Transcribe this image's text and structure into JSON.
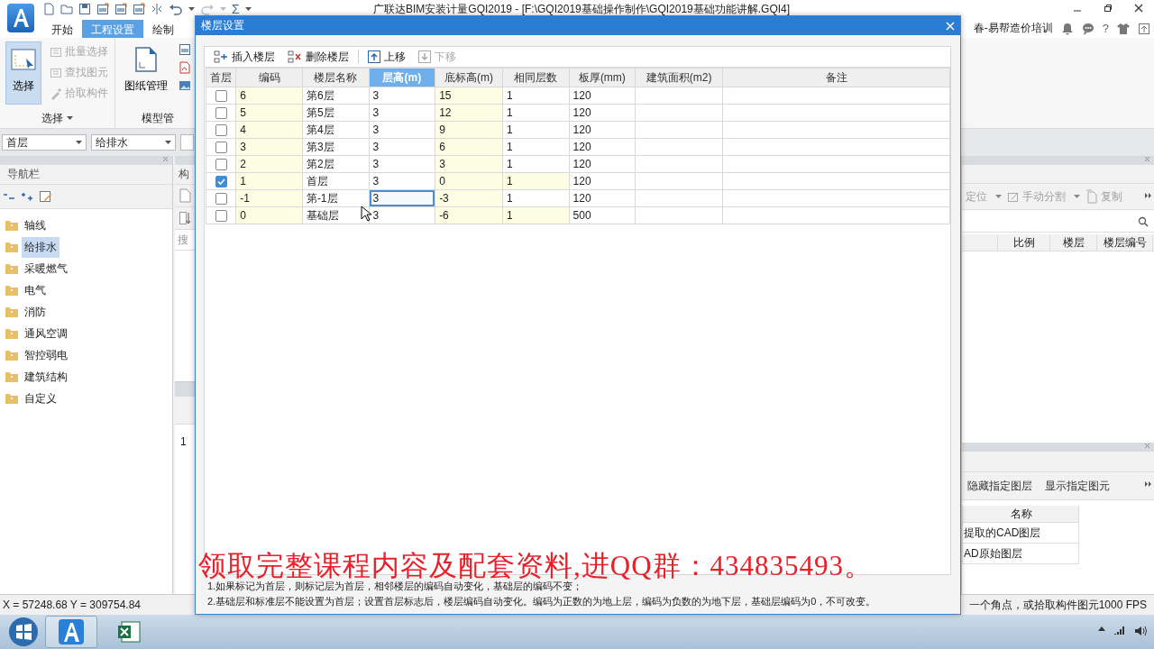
{
  "window": {
    "title": "广联达BIM安装计量GQI2019 - [F:\\GQI2019基础操作制作\\GQI2019基础功能讲解.GQI4]",
    "user": "春-易帮造价培训",
    "help_label": "?",
    "sum_symbol": "Σ"
  },
  "menu_tabs": [
    {
      "label": "开始",
      "selected": false
    },
    {
      "label": "工程设置",
      "selected": true
    },
    {
      "label": "绘制",
      "selected": false
    }
  ],
  "ribbon": {
    "groups": [
      {
        "label": "选择",
        "large": {
          "label": "选择",
          "selected": true
        },
        "small": [
          {
            "label": "批量选择",
            "disabled": true
          },
          {
            "label": "查找图元",
            "disabled": true
          },
          {
            "label": "拾取构件",
            "disabled": true
          }
        ]
      },
      {
        "label": "模型管",
        "large": {
          "label": "图纸管理",
          "selected": false
        }
      }
    ]
  },
  "selectors": [
    "首层",
    "给排水"
  ],
  "nav_panel": {
    "title": "导航栏",
    "items": [
      {
        "label": "轴线",
        "selected": false
      },
      {
        "label": "给排水",
        "selected": true
      },
      {
        "label": "采暖燃气",
        "selected": false
      },
      {
        "label": "电气",
        "selected": false
      },
      {
        "label": "消防",
        "selected": false
      },
      {
        "label": "通风空调",
        "selected": false
      },
      {
        "label": "智控弱电",
        "selected": false
      },
      {
        "label": "建筑结构",
        "selected": false
      },
      {
        "label": "自定义",
        "selected": false
      }
    ]
  },
  "middle_panel": {
    "title": "构",
    "search_placeholder": "搜",
    "row_number": "1"
  },
  "layer_panel": {
    "toolbar": [
      {
        "label": "定位",
        "dropdown": true
      },
      {
        "label": "手动分割",
        "dropdown": true
      },
      {
        "label": "复制",
        "dropdown": false
      }
    ],
    "columns": [
      "比例",
      "楼层",
      "楼层编号"
    ]
  },
  "cad_panel": {
    "toolbar": [
      "隐藏指定图层",
      "显示指定图元"
    ],
    "columns": [
      "名称"
    ],
    "rows": [
      "提取的CAD图层",
      "AD原始图层"
    ]
  },
  "status_bar": {
    "coordinates": "X = 57248.68 Y = 309754.84",
    "hint": "一个角点，或拾取构件图元1000 FPS"
  },
  "dialog": {
    "title": "楼层设置",
    "toolbar": [
      {
        "label": "插入楼层",
        "disabled": false
      },
      {
        "label": "删除楼层",
        "disabled": false
      },
      {
        "label": "上移",
        "disabled": false
      },
      {
        "label": "下移",
        "disabled": true
      }
    ],
    "checkbox_header": "首层",
    "columns": [
      {
        "label": "编码",
        "selected": false,
        "shaded": true
      },
      {
        "label": "楼层名称",
        "selected": false,
        "shaded": false
      },
      {
        "label": "层高(m)",
        "selected": true,
        "shaded": false
      },
      {
        "label": "底标高(m)",
        "selected": false,
        "shaded": true
      },
      {
        "label": "相同层数",
        "selected": false,
        "shaded": false
      },
      {
        "label": "板厚(mm)",
        "selected": false,
        "shaded": false
      },
      {
        "label": "建筑面积(m2)",
        "selected": false,
        "shaded": false
      },
      {
        "label": "备注",
        "selected": false,
        "shaded": false
      }
    ],
    "rows": [
      {
        "first_floor": false,
        "focused": false,
        "count_shaded": false,
        "cells": [
          "6",
          "第6层",
          "3",
          "15",
          "1",
          "120"
        ]
      },
      {
        "first_floor": false,
        "focused": false,
        "count_shaded": false,
        "cells": [
          "5",
          "第5层",
          "3",
          "12",
          "1",
          "120"
        ]
      },
      {
        "first_floor": false,
        "focused": false,
        "count_shaded": false,
        "cells": [
          "4",
          "第4层",
          "3",
          "9",
          "1",
          "120"
        ]
      },
      {
        "first_floor": false,
        "focused": false,
        "count_shaded": false,
        "cells": [
          "3",
          "第3层",
          "3",
          "6",
          "1",
          "120"
        ]
      },
      {
        "first_floor": false,
        "focused": false,
        "count_shaded": false,
        "cells": [
          "2",
          "第2层",
          "3",
          "3",
          "1",
          "120"
        ]
      },
      {
        "first_floor": true,
        "focused": false,
        "count_shaded": true,
        "cells": [
          "1",
          "首层",
          "3",
          "0",
          "1",
          "120"
        ]
      },
      {
        "first_floor": false,
        "focused": true,
        "count_shaded": false,
        "cells": [
          "-1",
          "第-1层",
          "3",
          "-3",
          "1",
          "120"
        ]
      },
      {
        "first_floor": false,
        "focused": false,
        "count_shaded": true,
        "cells": [
          "0",
          "基础层",
          "3",
          "-6",
          "1",
          "500"
        ]
      }
    ],
    "notes": [
      "1.如果标记为首层，则标记层为首层，相邻楼层的编码自动变化，基础层的编码不变；",
      "2.基础层和标准层不能设置为首层；设置首层标志后，楼层编码自动变化。编码为正数的为地上层，编码为负数的为地下层，基础层编码为0，不可改变。"
    ]
  },
  "overlay_caption": "领取完整课程内容及配套资料,进QQ群：434835493。"
}
